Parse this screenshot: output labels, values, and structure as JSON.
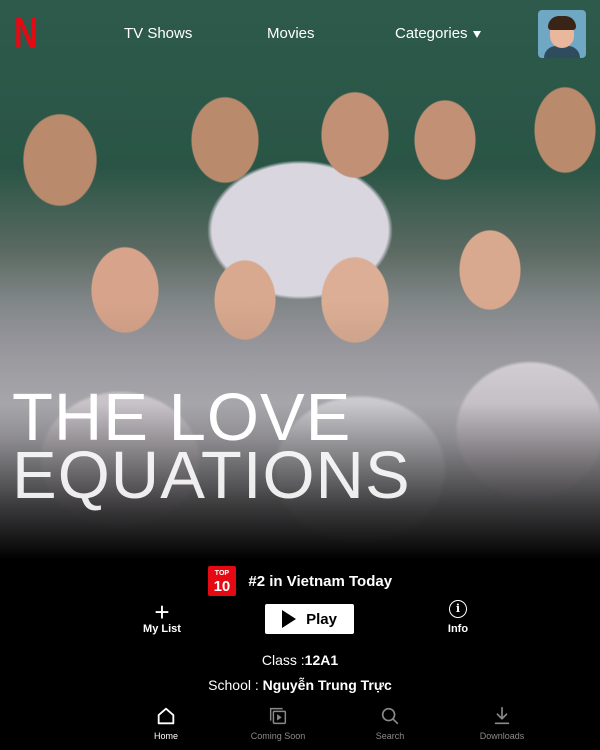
{
  "app": {
    "logo_letter": "N",
    "brand_color": "#e50914"
  },
  "nav": {
    "tv_shows": "TV Shows",
    "movies": "Movies",
    "categories": "Categories"
  },
  "profile": {
    "icon": "user-avatar-icon"
  },
  "title": {
    "line1": "THE LOVE",
    "line2": "EQUATIONS"
  },
  "badge": {
    "top": "TOP",
    "ten": "10",
    "rank_text": "#2 in Vietnam Today"
  },
  "actions": {
    "my_list": "My List",
    "play": "Play",
    "info": "Info",
    "info_glyph": "i",
    "plus_glyph": "+"
  },
  "details": {
    "class_label": "Class :",
    "class_value": "12A1",
    "school_label": "School :",
    "school_value": "Nguyễn Trung Trực"
  },
  "tabs": [
    {
      "label": "Home",
      "icon": "home-icon",
      "active": true
    },
    {
      "label": "Coming Soon",
      "icon": "coming-soon-icon",
      "active": false
    },
    {
      "label": "Search",
      "icon": "search-icon",
      "active": false
    },
    {
      "label": "Downloads",
      "icon": "download-icon",
      "active": false
    }
  ]
}
